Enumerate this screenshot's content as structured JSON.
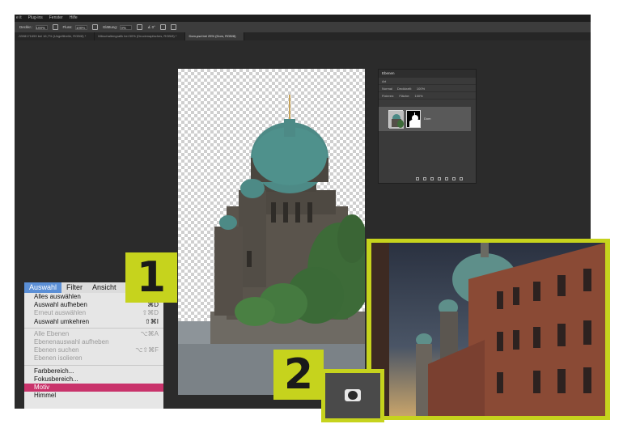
{
  "menubar": {
    "items": [
      "e it",
      "Plug-ins",
      "Fenster",
      "Hilfe"
    ]
  },
  "optionsbar": {
    "items": [
      {
        "label": "Deckkr.:",
        "value": "100%"
      },
      {
        "label": "Fluss:",
        "value": "100%"
      },
      {
        "label": "Glättung:",
        "value": "0%"
      },
      {
        "label": "∡",
        "value": "0°"
      }
    ]
  },
  "tabs": [
    {
      "label": "-3308171659 bei 16,7% (Ungefiltrelle, RGB/8) *"
    },
    {
      "label": "Mikschaltengrafik bei 50% (Druckmapfaches, RGB/8) *"
    },
    {
      "label": "Dom.psd bei 25% (Dom, RGB/8)"
    }
  ],
  "layers_panel": {
    "title": "Ebenen",
    "filter": "Art",
    "blend_mode": "Normal",
    "opacity_label": "Deckkraft:",
    "opacity": "100%",
    "lock_label": "Fixieren:",
    "fill_label": "Fläche:",
    "fill": "100%",
    "layer_name": "Dom"
  },
  "menu": {
    "bar": [
      {
        "label": "Auswahl",
        "selected": true
      },
      {
        "label": "Filter",
        "selected": false
      },
      {
        "label": "Ansicht",
        "selected": false
      },
      {
        "label": "Plu",
        "selected": false
      }
    ],
    "items": [
      {
        "label": "Alles auswählen",
        "shortcut": "",
        "enabled": true
      },
      {
        "label": "Auswahl aufheben",
        "shortcut": "⌘D",
        "enabled": true
      },
      {
        "label": "Erneut auswählen",
        "shortcut": "⇧⌘D",
        "enabled": false
      },
      {
        "label": "Auswahl umkehren",
        "shortcut": "⇧⌘I",
        "enabled": true
      },
      {
        "separator": true
      },
      {
        "label": "Alle Ebenen",
        "shortcut": "⌥⌘A",
        "enabled": false
      },
      {
        "label": "Ebenenauswahl aufheben",
        "shortcut": "",
        "enabled": false
      },
      {
        "label": "Ebenen suchen",
        "shortcut": "⌥⇧⌘F",
        "enabled": false
      },
      {
        "label": "Ebenen isolieren",
        "shortcut": "",
        "enabled": false
      },
      {
        "separator": true
      },
      {
        "label": "Farbbereich...",
        "shortcut": "",
        "enabled": true
      },
      {
        "label": "Fokusbereich...",
        "shortcut": "",
        "enabled": true
      },
      {
        "label": "Motiv",
        "shortcut": "",
        "enabled": true,
        "highlighted": true
      },
      {
        "label": "Himmel",
        "shortcut": "",
        "enabled": true
      }
    ]
  },
  "callouts": {
    "one": "1",
    "two": "2"
  },
  "colors": {
    "accent": "#c6d31d",
    "highlight": "#c9336b",
    "menu_selected": "#5b8fd6"
  },
  "icons": {
    "motiv_button": "select-subject-icon"
  }
}
